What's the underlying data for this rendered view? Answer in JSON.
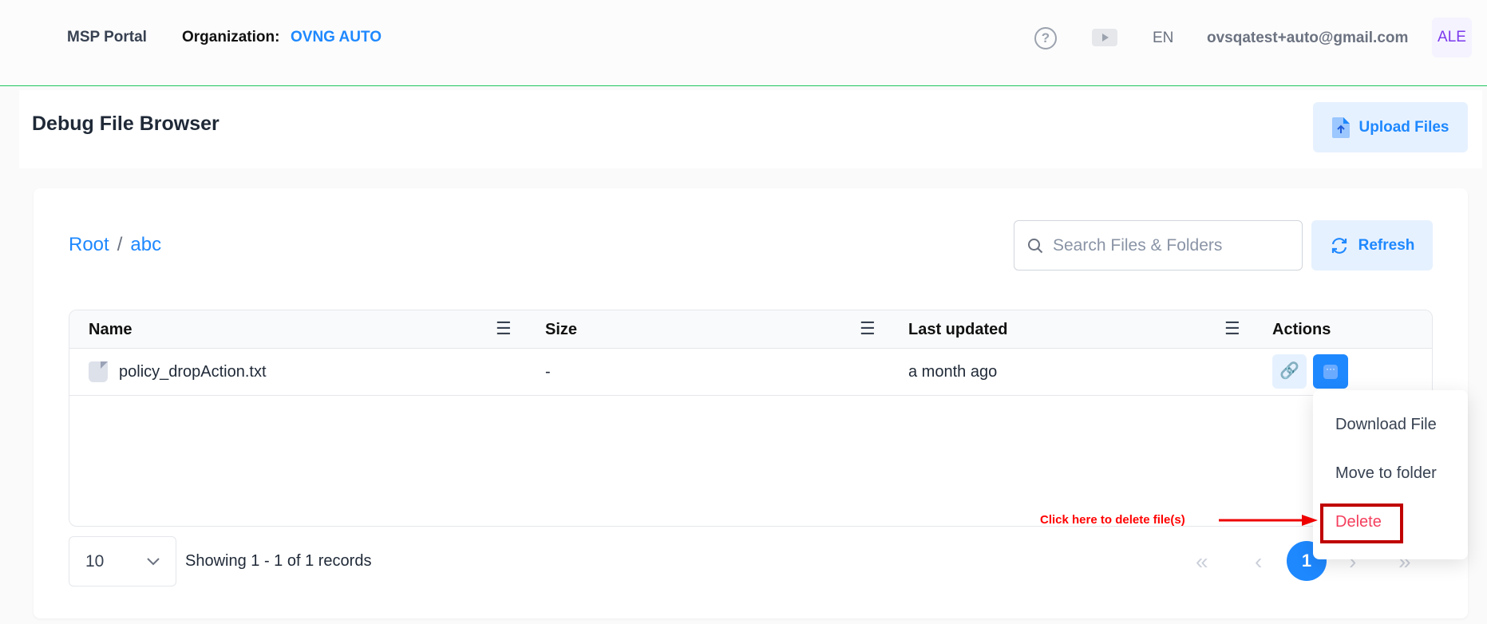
{
  "header": {
    "brand": "MSP Portal",
    "org_label": "Organization:",
    "org_value": "OVNG AUTO",
    "help_icon": "?",
    "language": "EN",
    "email": "ovsqatest+auto@gmail.com",
    "avatar": "ALE"
  },
  "page": {
    "title": "Debug File Browser",
    "upload_label": "Upload Files"
  },
  "browser": {
    "breadcrumb": [
      "Root",
      "abc"
    ],
    "breadcrumb_sep": "/",
    "search_placeholder": "Search Files & Folders",
    "refresh_label": "Refresh",
    "columns": [
      "Name",
      "Size",
      "Last updated",
      "Actions"
    ],
    "rows": [
      {
        "name": "policy_dropAction.txt",
        "size": "-",
        "updated": "a month ago"
      }
    ],
    "page_size": "10",
    "showing": "Showing 1 - 1 of 1 records",
    "current_page": "1",
    "menu": [
      "Download File",
      "Move to folder",
      "Delete"
    ]
  },
  "annotation": {
    "text": "Click here to delete file(s)",
    "color": "#ff0000"
  },
  "colors": {
    "accent": "#1e88ff",
    "danger": "#f43f5e",
    "divider": "#22c55e"
  }
}
